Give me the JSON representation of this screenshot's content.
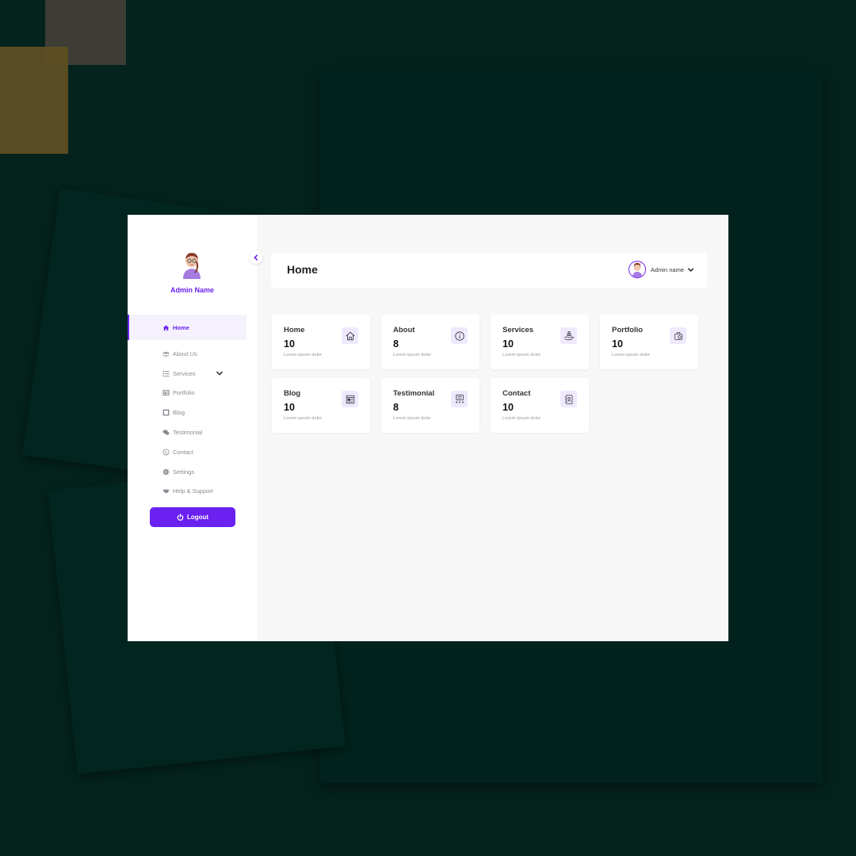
{
  "sidebar": {
    "admin_name": "Admin Name",
    "items": [
      {
        "label": "Home",
        "icon": "home-icon",
        "active": true
      },
      {
        "label": "About Us",
        "icon": "users-icon"
      },
      {
        "label": "Services",
        "icon": "list-icon",
        "has_submenu": true
      },
      {
        "label": "Portfolio",
        "icon": "table-icon"
      },
      {
        "label": "Blog",
        "icon": "square-icon"
      },
      {
        "label": "Testimonial",
        "icon": "comments-icon"
      },
      {
        "label": "Contact",
        "icon": "phone-icon"
      },
      {
        "label": "Settings",
        "icon": "gear-icon"
      },
      {
        "label": "Help & Support",
        "icon": "handshake-icon"
      }
    ],
    "logout_label": "Logout"
  },
  "header": {
    "title": "Home",
    "user_name": "Admin name"
  },
  "cards": [
    {
      "title": "Home",
      "value": "10",
      "subtitle": "Lorem ipsum dolor",
      "icon": "home-icon"
    },
    {
      "title": "About",
      "value": "8",
      "subtitle": "Lorem ipsum dolor",
      "icon": "info-icon"
    },
    {
      "title": "Services",
      "value": "10",
      "subtitle": "Lorem ipsum dolor",
      "icon": "service-hand-icon"
    },
    {
      "title": "Portfolio",
      "value": "10",
      "subtitle": "Lorem ipsum dolor",
      "icon": "portfolio-icon"
    },
    {
      "title": "Blog",
      "value": "10",
      "subtitle": "Lorem ipsum dolor",
      "icon": "blog-icon"
    },
    {
      "title": "Testimonial",
      "value": "8",
      "subtitle": "Lorem ipsum dolor",
      "icon": "review-icon"
    },
    {
      "title": "Contact",
      "value": "10",
      "subtitle": "Lorem ipsum dolor",
      "icon": "contact-book-icon"
    }
  ],
  "colors": {
    "accent": "#6b21f0",
    "background": "#04231d",
    "content_bg": "#f7f7f8",
    "card_icon_bg": "#efe9fd"
  }
}
